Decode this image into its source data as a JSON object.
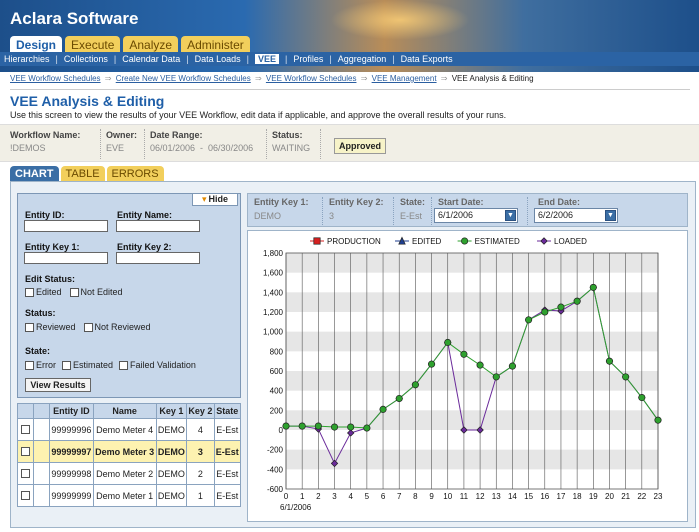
{
  "app": {
    "title": "Aclara Software"
  },
  "main_tabs": [
    {
      "label": "Design",
      "active": true
    },
    {
      "label": "Execute",
      "active": false
    },
    {
      "label": "Analyze",
      "active": false
    },
    {
      "label": "Administer",
      "active": false
    }
  ],
  "subnav": [
    {
      "label": "Hierarchies"
    },
    {
      "label": "Collections"
    },
    {
      "label": "Calendar Data"
    },
    {
      "label": "Data Loads"
    },
    {
      "label": "VEE",
      "active": true
    },
    {
      "label": "Profiles"
    },
    {
      "label": "Aggregation"
    },
    {
      "label": "Data Exports"
    }
  ],
  "breadcrumb": [
    "VEE Workflow Schedules",
    "Create New VEE Workflow Schedules",
    "VEE Workflow Schedules",
    "VEE Management",
    "VEE Analysis & Editing"
  ],
  "page": {
    "title": "VEE Analysis & Editing",
    "description": "Use this screen to view the results of your VEE Workflow, edit data if applicable, and approve the overall results of your runs."
  },
  "workflow": {
    "name_label": "Workflow Name:",
    "name_value": "!DEMOS",
    "owner_label": "Owner:",
    "owner_value": "EVE",
    "range_label": "Date Range:",
    "range_value": "06/01/2006  -  06/30/2006",
    "status_label": "Status:",
    "status_value": "WAITING",
    "approved_label": "Approved"
  },
  "sub_tabs": [
    {
      "label": "CHART",
      "active": true
    },
    {
      "label": "TABLE",
      "active": false
    },
    {
      "label": "ERRORS",
      "active": false
    }
  ],
  "filter": {
    "hide_label": "Hide",
    "entity_id_label": "Entity ID:",
    "entity_name_label": "Entity Name:",
    "entity_key1_label": "Entity Key 1:",
    "entity_key2_label": "Entity Key 2:",
    "edit_status_label": "Edit Status:",
    "edited_label": "Edited",
    "not_edited_label": "Not Edited",
    "status_label": "Status:",
    "reviewed_label": "Reviewed",
    "not_reviewed_label": "Not Reviewed",
    "state_label": "State:",
    "error_label": "Error",
    "estimated_label": "Estimated",
    "failed_label": "Failed Validation",
    "view_results_label": "View Results"
  },
  "table": {
    "headers": [
      "",
      "Entity ID",
      "Name",
      "Key 1",
      "Key 2",
      "State"
    ],
    "rows": [
      {
        "id": "99999996",
        "name": "Demo Meter 4",
        "key1": "DEMO",
        "key2": "4",
        "state": "E-Est",
        "selected": false
      },
      {
        "id": "99999997",
        "name": "Demo Meter 3",
        "key1": "DEMO",
        "key2": "3",
        "state": "E-Est",
        "selected": true
      },
      {
        "id": "99999998",
        "name": "Demo Meter 2",
        "key1": "DEMO",
        "key2": "2",
        "state": "E-Est",
        "selected": false
      },
      {
        "id": "99999999",
        "name": "Demo Meter 1",
        "key1": "DEMO",
        "key2": "1",
        "state": "E-Est",
        "selected": false
      }
    ]
  },
  "entity": {
    "key1_label": "Entity Key 1:",
    "key1_value": "DEMO",
    "key2_label": "Entity Key 2:",
    "key2_value": "3",
    "state_label": "State:",
    "state_value": "E-Est",
    "start_label": "Start Date:",
    "start_value": "6/1/2006",
    "end_label": "End Date:",
    "end_value": "6/2/2006"
  },
  "chart_data": {
    "type": "line",
    "x": [
      0,
      1,
      2,
      3,
      4,
      5,
      6,
      7,
      8,
      9,
      10,
      11,
      12,
      13,
      14,
      15,
      16,
      17,
      18,
      19,
      20,
      21,
      22,
      23
    ],
    "x_tick_labels": [
      "0",
      "1",
      "2",
      "3",
      "4",
      "5",
      "6",
      "7",
      "8",
      "9",
      "10",
      "11",
      "12",
      "13",
      "14",
      "15",
      "16",
      "17",
      "18",
      "19",
      "20",
      "21",
      "22",
      "23"
    ],
    "x_sub_label": "6/1/2006",
    "ylim": [
      -600,
      1800
    ],
    "y_ticks": [
      -600,
      -400,
      -200,
      0,
      200,
      400,
      600,
      800,
      1000,
      1200,
      1400,
      1600,
      1800
    ],
    "y_tick_labels": [
      "-600",
      "-400",
      "-200",
      "0",
      "200",
      "400",
      "600",
      "800",
      "1,000",
      "1,200",
      "1,400",
      "1,600",
      "1,800"
    ],
    "legend_position": "top",
    "series": [
      {
        "name": "PRODUCTION",
        "color": "#d62020",
        "marker": "square",
        "values": []
      },
      {
        "name": "EDITED",
        "color": "#1f3f8f",
        "marker": "triangle",
        "values": []
      },
      {
        "name": "ESTIMATED",
        "color": "#2ea12e",
        "marker": "circle",
        "values": [
          40,
          40,
          40,
          30,
          30,
          20,
          210,
          320,
          460,
          670,
          890,
          770,
          660,
          540,
          650,
          1120,
          1200,
          1250,
          1310,
          1450,
          700,
          540,
          330,
          100
        ]
      },
      {
        "name": "LOADED",
        "color": "#6a2a9a",
        "marker": "diamond",
        "values": [
          40,
          40,
          10,
          -340,
          -30,
          20,
          210,
          320,
          460,
          670,
          890,
          0,
          0,
          540,
          650,
          1120,
          1220,
          1210,
          1310,
          1450,
          700,
          540,
          330,
          100
        ]
      }
    ]
  }
}
